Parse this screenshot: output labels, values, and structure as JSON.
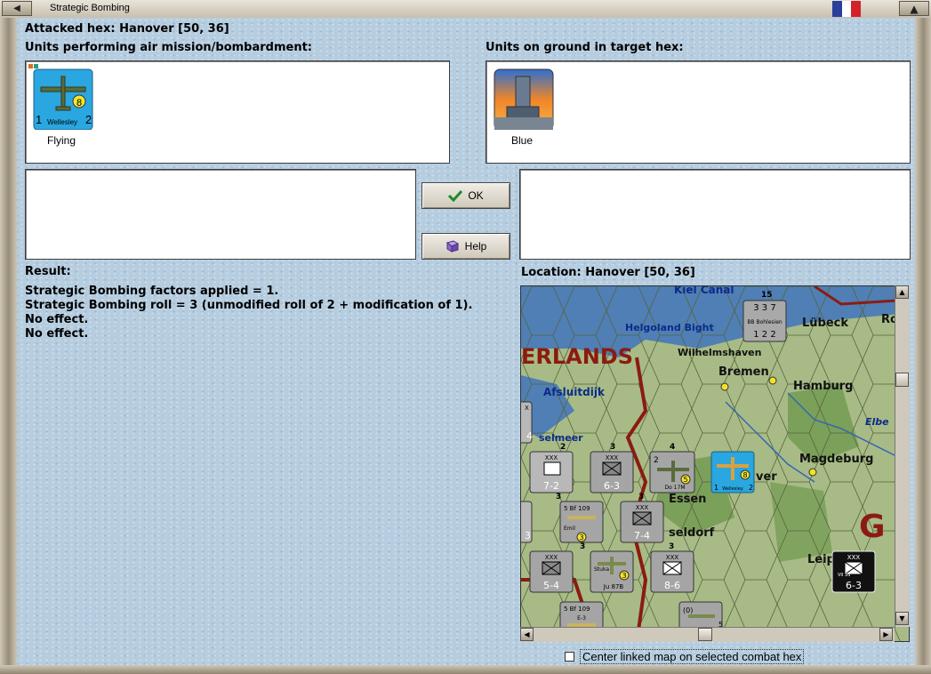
{
  "window": {
    "title": "Strategic Bombing"
  },
  "header": {
    "attacked_hex": "Attacked hex: Hanover  [50, 36]"
  },
  "air_units": {
    "label": "Units performing air mission/bombardment:",
    "unit": {
      "name": "Wellesley",
      "left": "1",
      "right": "2",
      "strength": "8",
      "caption": "Flying"
    }
  },
  "ground_units": {
    "label": "Units on ground in target hex:",
    "unit": {
      "caption": "Blue"
    }
  },
  "buttons": {
    "ok": "OK",
    "help": "Help"
  },
  "result": {
    "label": "Result:",
    "lines": [
      "Strategic Bombing factors applied = 1.",
      "Strategic Bombing roll = 3 (unmodified roll of 2 + modification of 1).",
      "No effect.",
      "No effect."
    ]
  },
  "location": {
    "label": "Location:  Hanover  [50, 36]",
    "map_labels": [
      "Kiel Canal",
      "Helgoland Bight",
      "Lübeck",
      "Rosto",
      "ERLANDS",
      "Wilhelmshaven",
      "Bremen",
      "Hamburg",
      "Afsluitdijk",
      "Elbe",
      "selmeer",
      "Magdeburg",
      "ver",
      "Essen",
      "seldorf",
      "Leip",
      "G"
    ],
    "counters": [
      {
        "top": "3  3  7",
        "mid": "BB Bohlesien",
        "bottom": "1  2  2",
        "stack": "15"
      },
      {
        "top": "XXX",
        "value": "7-2",
        "stack": "2"
      },
      {
        "top": "XXX",
        "value": "6-3",
        "stack": "3"
      },
      {
        "top": "2",
        "mid": "Do 17M",
        "strength": "5",
        "stack": "4"
      },
      {
        "top": "",
        "mid": "Wellesley",
        "strength": "8",
        "left": "1",
        "right": "2"
      },
      {
        "top": "5  Bf 109",
        "mid": "Emil",
        "strength": "3",
        "stack": "3"
      },
      {
        "top": "XXX",
        "value": "7-4",
        "stack": "3"
      },
      {
        "top": "XXX",
        "value": "5-4"
      },
      {
        "top": "Stuka",
        "mid": "Ju 87B",
        "strength": "3",
        "stack": "3"
      },
      {
        "top": "XXX",
        "value": "8-6",
        "stack": "3"
      },
      {
        "top": "XXX",
        "value": "6-3",
        "side": "VII SS"
      },
      {
        "top": "5  Bf 109",
        "mid": "E-3"
      },
      {
        "top": "(0)",
        "mid": "",
        "strength": "5"
      },
      {
        "top": "X",
        "value": "4"
      },
      {
        "top": "",
        "value": "3"
      }
    ]
  },
  "option": {
    "center_linked_map": "Center linked map on selected combat hex"
  },
  "colors": {
    "background": "#b6cde0",
    "air_counter": "#2aa6e0",
    "ground_counter": "#9a9a9a",
    "land": "#9fb78a",
    "sea": "#4f7fb4",
    "border": "#8b1b12"
  }
}
